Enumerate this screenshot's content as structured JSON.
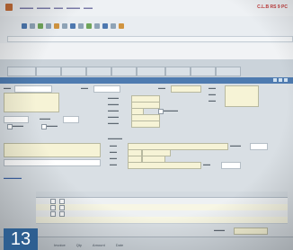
{
  "page_number": "13",
  "colors": {
    "accent": "#4e7bb0",
    "badge": "#2e5f91",
    "field_fill": "#f6f3d6"
  },
  "menubar": {
    "brand": "C.L.B RS 9 PC"
  },
  "footer": {
    "columns": [
      "Invoice",
      "Qty",
      "Amount",
      "Date"
    ]
  }
}
